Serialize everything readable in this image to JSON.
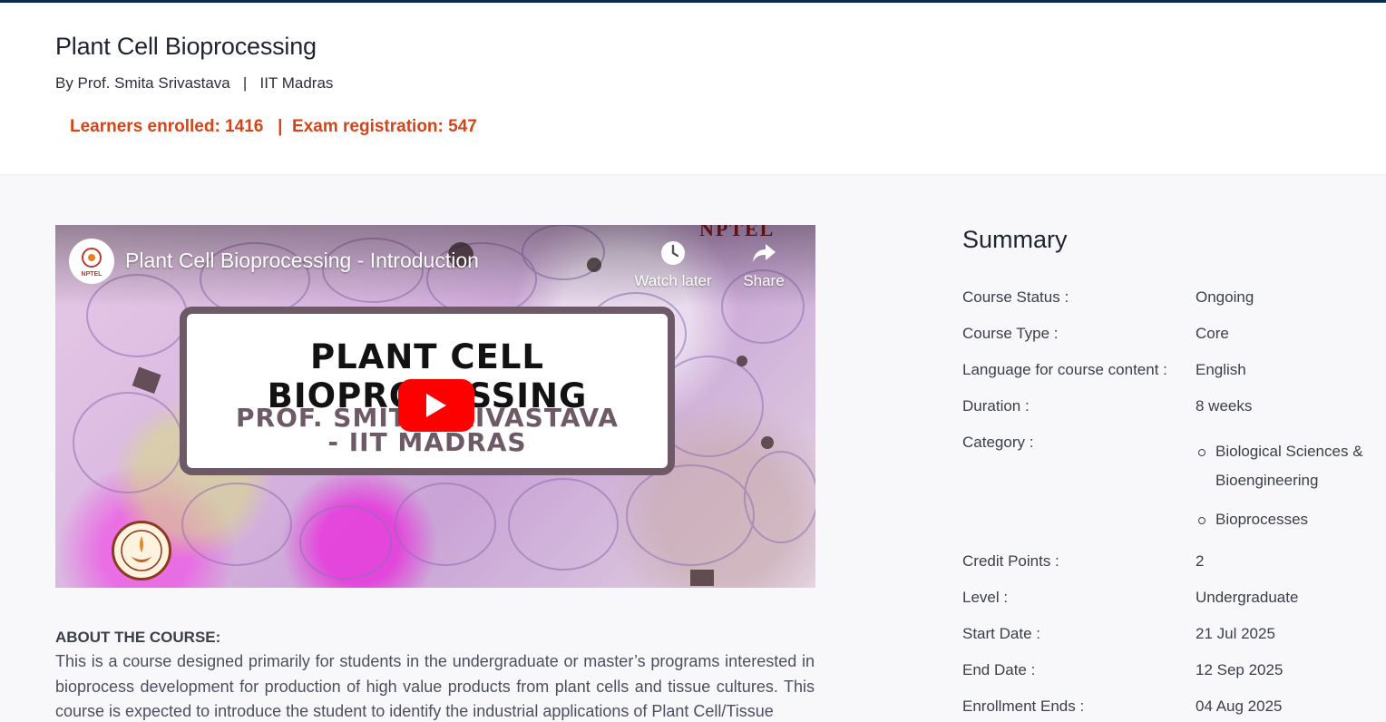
{
  "course": {
    "title": "Plant Cell Bioprocessing",
    "byline": "By Prof. Smita Srivastava   |   IIT Madras",
    "stats": "Learners enrolled: 1416   |  Exam registration: 547"
  },
  "video": {
    "title": "Plant Cell Bioprocessing - Introduction",
    "watch_later": "Watch later",
    "share": "Share",
    "card_line1": "PLANT CELL BIOPROCESSING",
    "card_line2": "PROF. SMITA SRIVASTAVA",
    "card_line3": "- IIT MADRAS",
    "channel": "NPTEL",
    "brand_colors": {
      "play": "#ff0000",
      "card_border": "#6d5a66"
    }
  },
  "about": {
    "heading": "ABOUT THE COURSE:",
    "text": "This is a course designed primarily for students in the undergraduate or master’s programs interested in bioprocess development for production of high value products from plant cells and tissue cultures. This course is expected to introduce the student to identify the industrial applications of Plant Cell/Tissue"
  },
  "summary": {
    "title": "Summary",
    "rows": [
      {
        "label": "Course Status :",
        "value": "Ongoing"
      },
      {
        "label": "Course Type :",
        "value": "Core"
      },
      {
        "label": "Language for course content :",
        "value": "English"
      },
      {
        "label": "Duration :",
        "value": "8 weeks"
      },
      {
        "label": "Category :",
        "value": ""
      },
      {
        "label": "Credit Points :",
        "value": "2"
      },
      {
        "label": "Level :",
        "value": "Undergraduate"
      },
      {
        "label": "Start Date :",
        "value": "21 Jul 2025"
      },
      {
        "label": "End Date :",
        "value": "12 Sep 2025"
      },
      {
        "label": "Enrollment Ends :",
        "value": "04 Aug 2025"
      }
    ],
    "categories": [
      "Biological Sciences & Bioengineering",
      "Bioprocesses"
    ]
  },
  "colors": {
    "accent": "#d84315",
    "top_bar": "#0d2a55"
  }
}
